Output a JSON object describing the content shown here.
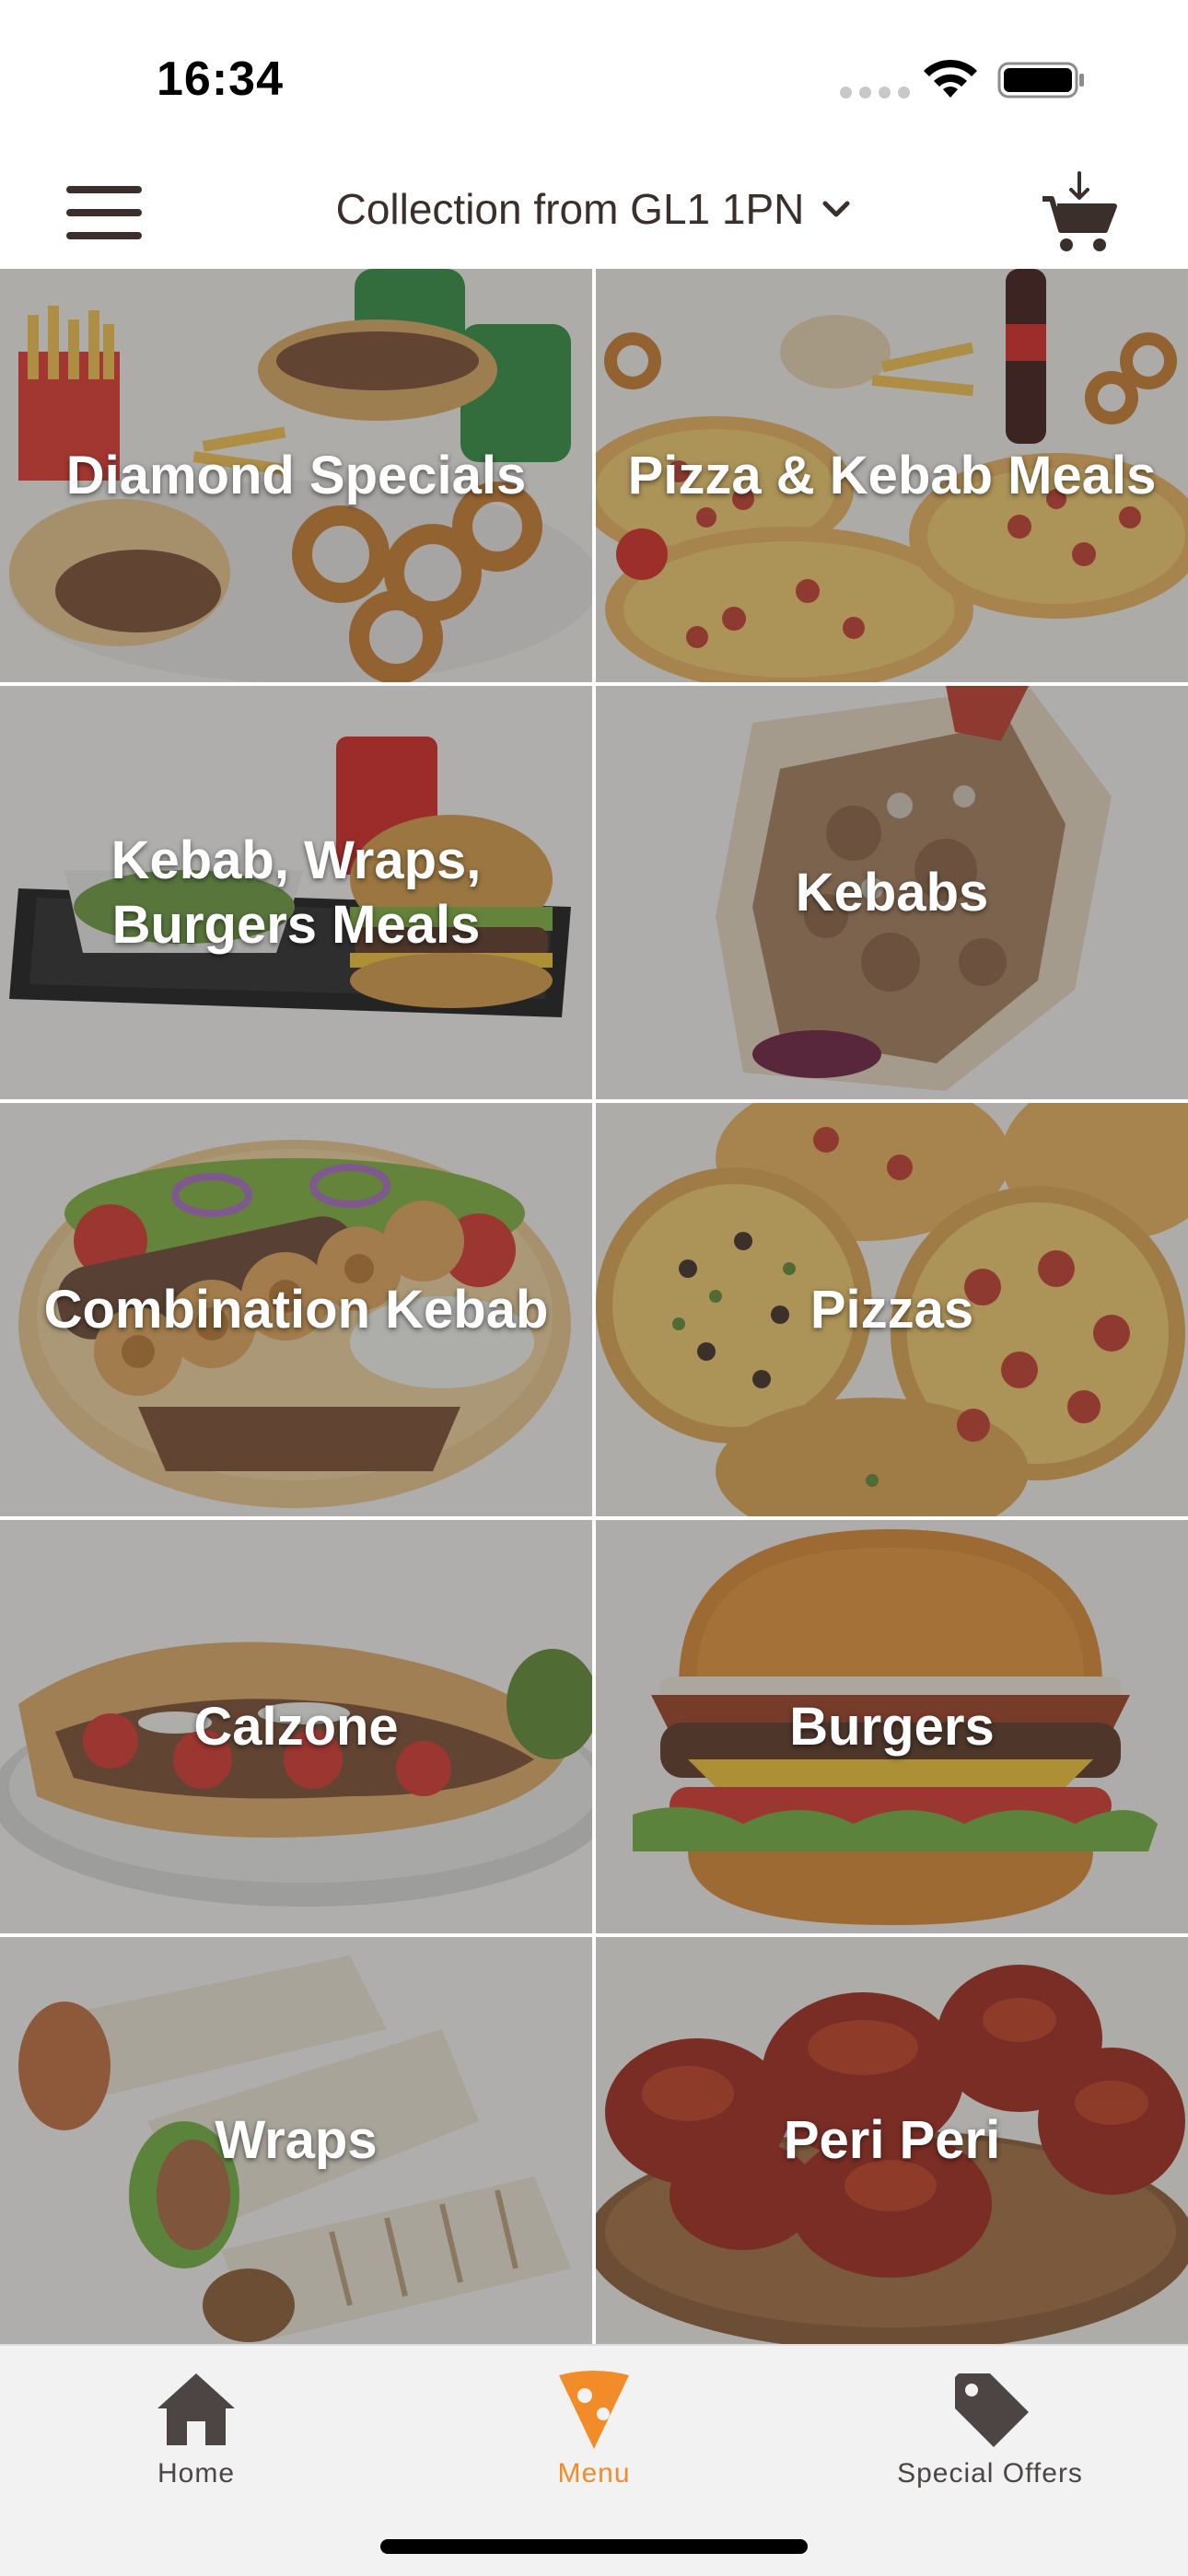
{
  "status_bar": {
    "time": "16:34"
  },
  "header": {
    "location_label": "Collection from GL1 1PN"
  },
  "categories": [
    {
      "label": "Diamond Specials"
    },
    {
      "label": "Pizza & Kebab Meals"
    },
    {
      "label": "Kebab, Wraps,\nBurgers Meals"
    },
    {
      "label": "Kebabs"
    },
    {
      "label": "Combination Kebab"
    },
    {
      "label": "Pizzas"
    },
    {
      "label": "Calzone"
    },
    {
      "label": "Burgers"
    },
    {
      "label": "Wraps"
    },
    {
      "label": "Peri Peri"
    }
  ],
  "tab_bar": {
    "tabs": [
      {
        "label": "Home",
        "icon": "home-icon",
        "active": false
      },
      {
        "label": "Menu",
        "icon": "pizza-slice-icon",
        "active": true
      },
      {
        "label": "Special Offers",
        "icon": "tag-icon",
        "active": false
      }
    ]
  },
  "colors": {
    "accent": "#f28c28",
    "dark": "#4d4543",
    "tile_overlay": "#3c3c3c"
  }
}
